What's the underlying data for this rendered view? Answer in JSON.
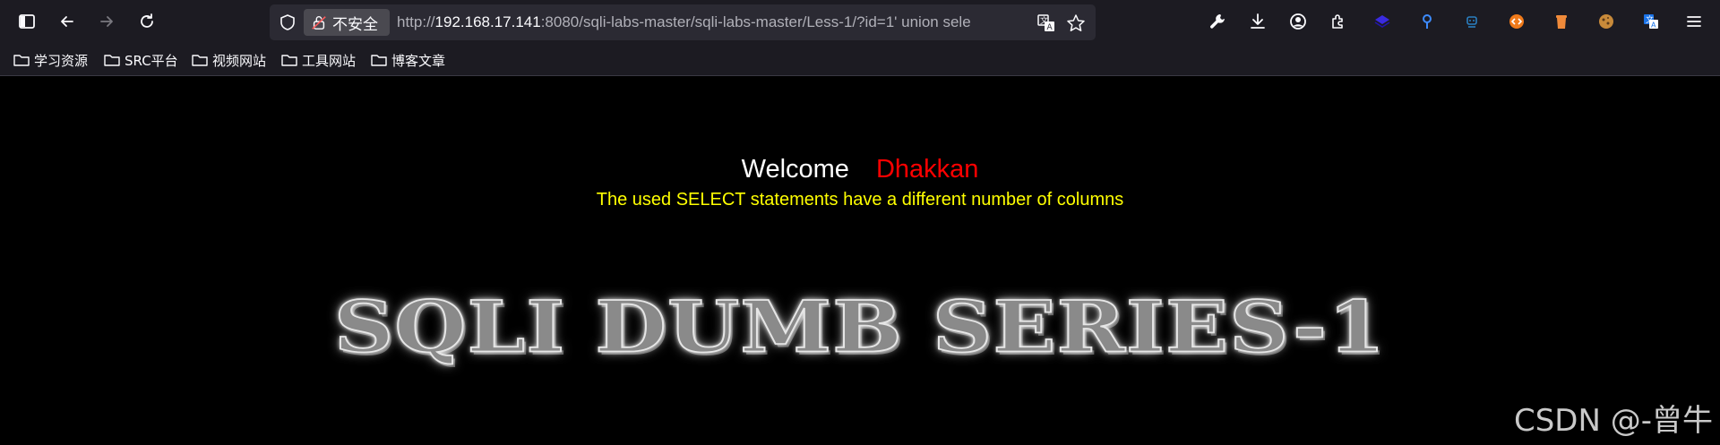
{
  "browser": {
    "security_label": "不安全",
    "url_prefix": "http://",
    "url_host": "192.168.17.141",
    "url_rest": ":8080/sqli-labs-master/sqli-labs-master/Less-1/?id=1' union sele",
    "icons": {
      "sidebar": "sidebar-icon",
      "back": "back-arrow-icon",
      "forward": "forward-arrow-icon",
      "reload": "reload-icon",
      "tracking": "shield-icon",
      "lock": "insecure-lock-icon",
      "translate": "translate-icon",
      "bookmark": "star-icon",
      "tools": "wrench-icon",
      "downloads": "download-icon",
      "account": "account-icon",
      "extensions": "puzzle-icon"
    }
  },
  "bookmarks": [
    {
      "label": "学习资源"
    },
    {
      "label": "SRC平台"
    },
    {
      "label": "视频网站"
    },
    {
      "label": "工具网站"
    },
    {
      "label": "博客文章"
    }
  ],
  "page": {
    "welcome": "Welcome",
    "name": "Dhakkan",
    "error": "The used SELECT statements have a different number of columns",
    "banner": "SQLI DUMB SERIES-1"
  },
  "watermark": "CSDN @-曾牛",
  "colors": {
    "chrome_bg": "#1c1b22",
    "urlbar_bg": "#2b2a33",
    "page_bg": "#000000",
    "welcome": "#ffffff",
    "name": "#ff0000",
    "error": "#ffff00"
  }
}
